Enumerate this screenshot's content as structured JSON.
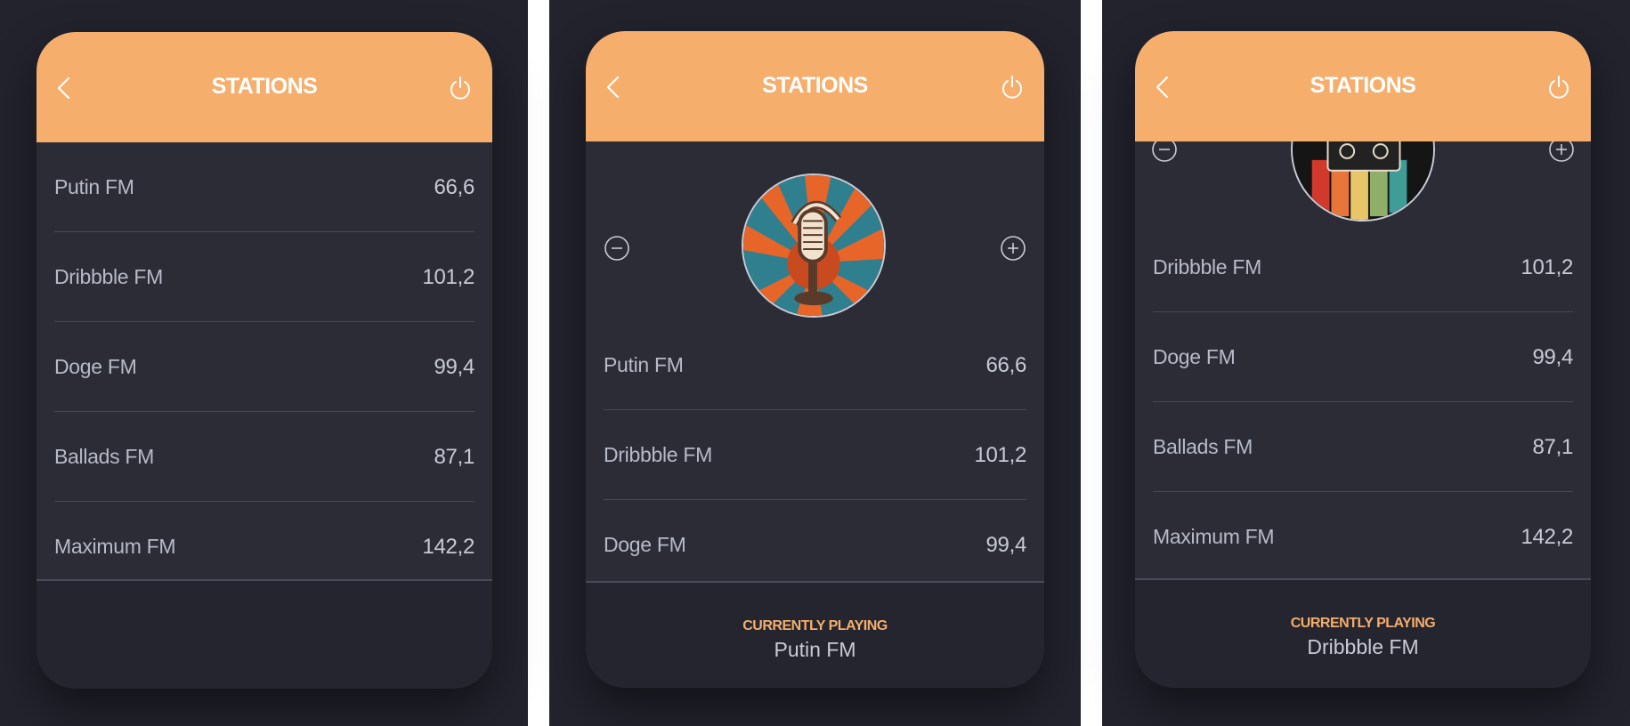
{
  "screens": [
    {
      "header": {
        "title": "STATIONS",
        "back_icon": "chevron-left-icon",
        "power_icon": "power-icon"
      },
      "stations": [
        {
          "name": "Putin FM",
          "freq": "66,6"
        },
        {
          "name": "Dribbble FM",
          "freq": "101,2"
        },
        {
          "name": "Doge FM",
          "freq": "99,4"
        },
        {
          "name": "Ballads FM",
          "freq": "87,1"
        },
        {
          "name": "Maximum FM",
          "freq": "142,2"
        }
      ]
    },
    {
      "header": {
        "title": "STATIONS",
        "back_icon": "chevron-left-icon",
        "power_icon": "power-icon"
      },
      "player": {
        "minus_icon": "minus-circle-icon",
        "plus_icon": "plus-circle-icon",
        "artwork": "microphone-artwork"
      },
      "stations": [
        {
          "name": "Putin FM",
          "freq": "66,6"
        },
        {
          "name": "Dribbble FM",
          "freq": "101,2"
        },
        {
          "name": "Doge FM",
          "freq": "99,4"
        }
      ],
      "footer": {
        "label": "CURRENTLY PLAYING",
        "station": "Putin FM"
      }
    },
    {
      "header": {
        "title": "STATIONS",
        "back_icon": "chevron-left-icon",
        "power_icon": "power-icon"
      },
      "player": {
        "minus_icon": "minus-circle-icon",
        "plus_icon": "plus-circle-icon",
        "artwork": "cassette-artwork"
      },
      "stations": [
        {
          "name": "Dribbble FM",
          "freq": "101,2"
        },
        {
          "name": "Doge FM",
          "freq": "99,4"
        },
        {
          "name": "Ballads FM",
          "freq": "87,1"
        },
        {
          "name": "Maximum FM",
          "freq": "142,2"
        }
      ],
      "footer": {
        "label": "CURRENTLY PLAYING",
        "station": "Dribbble FM"
      }
    }
  ],
  "colors": {
    "accent": "#f5ae6c",
    "background": "#22232d",
    "card": "#2b2c36",
    "text": "#b7bac7"
  }
}
